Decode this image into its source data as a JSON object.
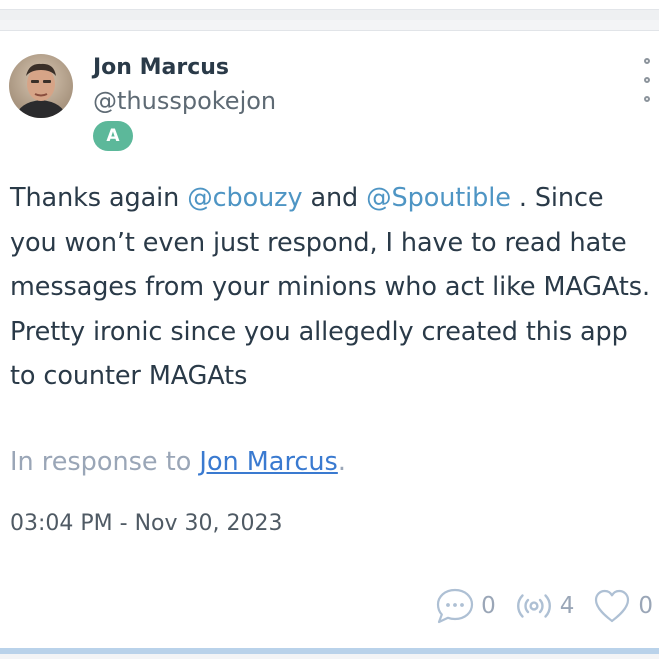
{
  "post": {
    "author": {
      "display_name": "Jon Marcus",
      "handle": "@thusspokejon",
      "badge": "A",
      "badge_color": "#5cb89a"
    },
    "body": {
      "part1": "Thanks again ",
      "mention1": "@cbouzy",
      "part2": " and ",
      "mention2": "@Spoutible",
      "part3": " . Since you won’t even just respond, I have to read hate messages from your minions who act like MAGAts. Pretty ironic since you allegedly created this app to counter MAGAts"
    },
    "in_response": {
      "prefix": "In response to ",
      "link": "Jon Marcus",
      "suffix": "."
    },
    "timestamp": "03:04 PM - Nov 30, 2023",
    "actions": {
      "reply": {
        "icon": "comment-bubble-icon",
        "count": "0"
      },
      "respout": {
        "icon": "broadcast-icon",
        "count": "4"
      },
      "like": {
        "icon": "heart-icon",
        "count": "0"
      }
    }
  },
  "colors": {
    "text": "#2a3a48",
    "mention": "#4e95c4",
    "muted": "#9aa6b7",
    "link": "#3a7ad0",
    "icon": "#aec0d4"
  }
}
